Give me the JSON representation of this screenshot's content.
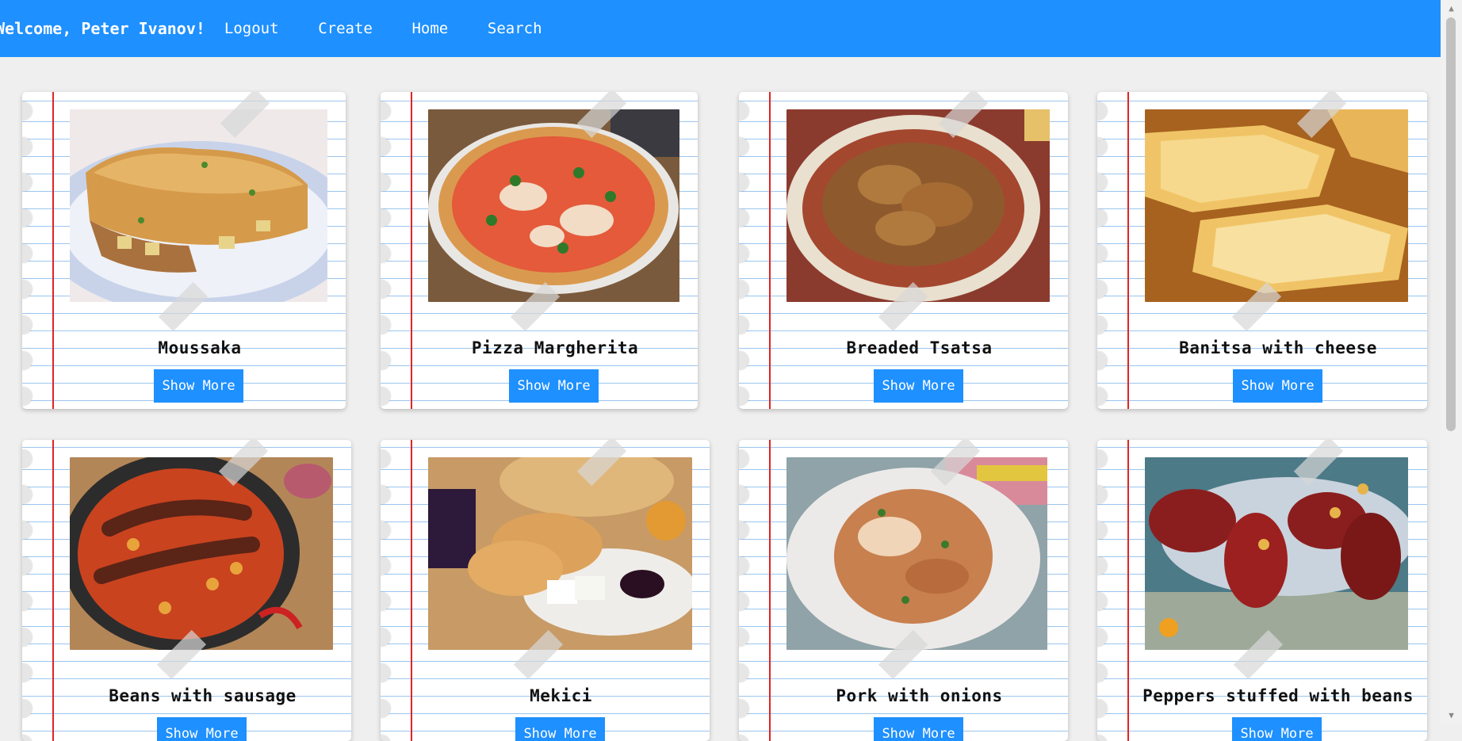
{
  "header": {
    "welcome": "Welcome, Peter Ivanov!",
    "nav": [
      "Logout",
      "Create",
      "Home",
      "Search"
    ],
    "accent": "#1e90ff"
  },
  "recipes": [
    {
      "name": "Moussaka",
      "button": "Show More"
    },
    {
      "name": "Pizza Margherita",
      "button": "Show More"
    },
    {
      "name": "Breaded Tsatsa",
      "button": "Show More"
    },
    {
      "name": "Banitsa with cheese",
      "button": "Show More"
    },
    {
      "name": "Beans with sausage",
      "button": "Show More"
    },
    {
      "name": "Mekici",
      "button": "Show More"
    },
    {
      "name": "Pork with onions",
      "button": "Show More"
    },
    {
      "name": "Peppers stuffed with beans",
      "button": "Show More"
    }
  ]
}
